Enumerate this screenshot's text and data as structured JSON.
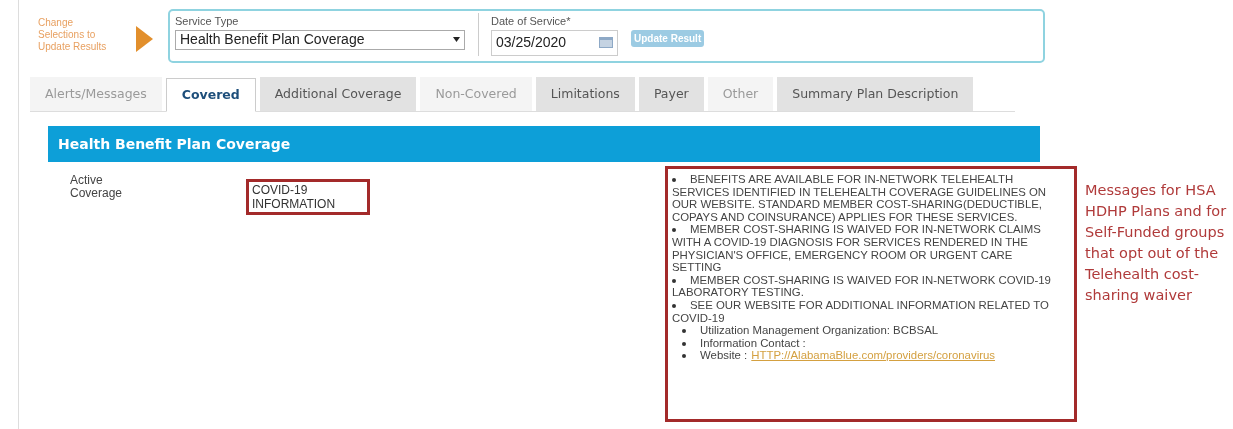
{
  "hint": "Change Selections to Update Results",
  "service_type": {
    "label": "Service Type",
    "value": "Health Benefit Plan Coverage"
  },
  "date_of_service": {
    "label": "Date of Service*",
    "value": "03/25/2020"
  },
  "update_button": {
    "label": "Update Result",
    "disabled": true
  },
  "tabs": [
    {
      "label": "Alerts/Messages",
      "selected": false,
      "disabled": true
    },
    {
      "label": "Covered",
      "selected": true,
      "disabled": false
    },
    {
      "label": "Additional Coverage",
      "selected": false,
      "disabled": false
    },
    {
      "label": "Non-Covered",
      "selected": false,
      "disabled": true
    },
    {
      "label": "Limitations",
      "selected": false,
      "disabled": false
    },
    {
      "label": "Payer",
      "selected": false,
      "disabled": false
    },
    {
      "label": "Other",
      "selected": false,
      "disabled": true
    },
    {
      "label": "Summary Plan Description",
      "selected": false,
      "disabled": false
    }
  ],
  "section": {
    "title": "Health Benefit Plan Coverage",
    "row": {
      "label": "Active Coverage",
      "value": "COVID-19 INFORMATION",
      "messages": [
        {
          "kind": "wide",
          "text": "BENEFITS ARE AVAILABLE FOR IN-NETWORK TELEHEALTH SERVICES IDENTIFIED IN TELEHEALTH COVERAGE GUIDELINES ON OUR WEBSITE. STANDARD MEMBER COST-SHARING(DEDUCTIBLE, COPAYS AND COINSURANCE) APPLIES FOR THESE SERVICES."
        },
        {
          "kind": "wide",
          "text": "MEMBER COST-SHARING IS WAIVED FOR IN-NETWORK CLAIMS WITH A COVID-19 DIAGNOSIS FOR SERVICES RENDERED IN THE PHYSICIAN'S OFFICE, EMERGENCY ROOM OR URGENT CARE SETTING"
        },
        {
          "kind": "wide",
          "text": "MEMBER COST-SHARING IS WAIVED FOR IN-NETWORK COVID-19 LABORATORY TESTING."
        },
        {
          "kind": "wide",
          "text": "SEE OUR WEBSITE FOR ADDITIONAL INFORMATION RELATED TO COVID-19"
        },
        {
          "kind": "item",
          "text": "Utilization Management Organization: BCBSAL"
        },
        {
          "kind": "item",
          "text": "Information Contact :"
        },
        {
          "kind": "link",
          "text": "Website :",
          "link": "HTTP://AlabamaBlue.com/providers/coronavirus"
        }
      ]
    }
  },
  "annotation": "Messages for HSA HDHP Plans and for Self-Funded groups that opt out of the Telehealth cost-sharing waiver"
}
